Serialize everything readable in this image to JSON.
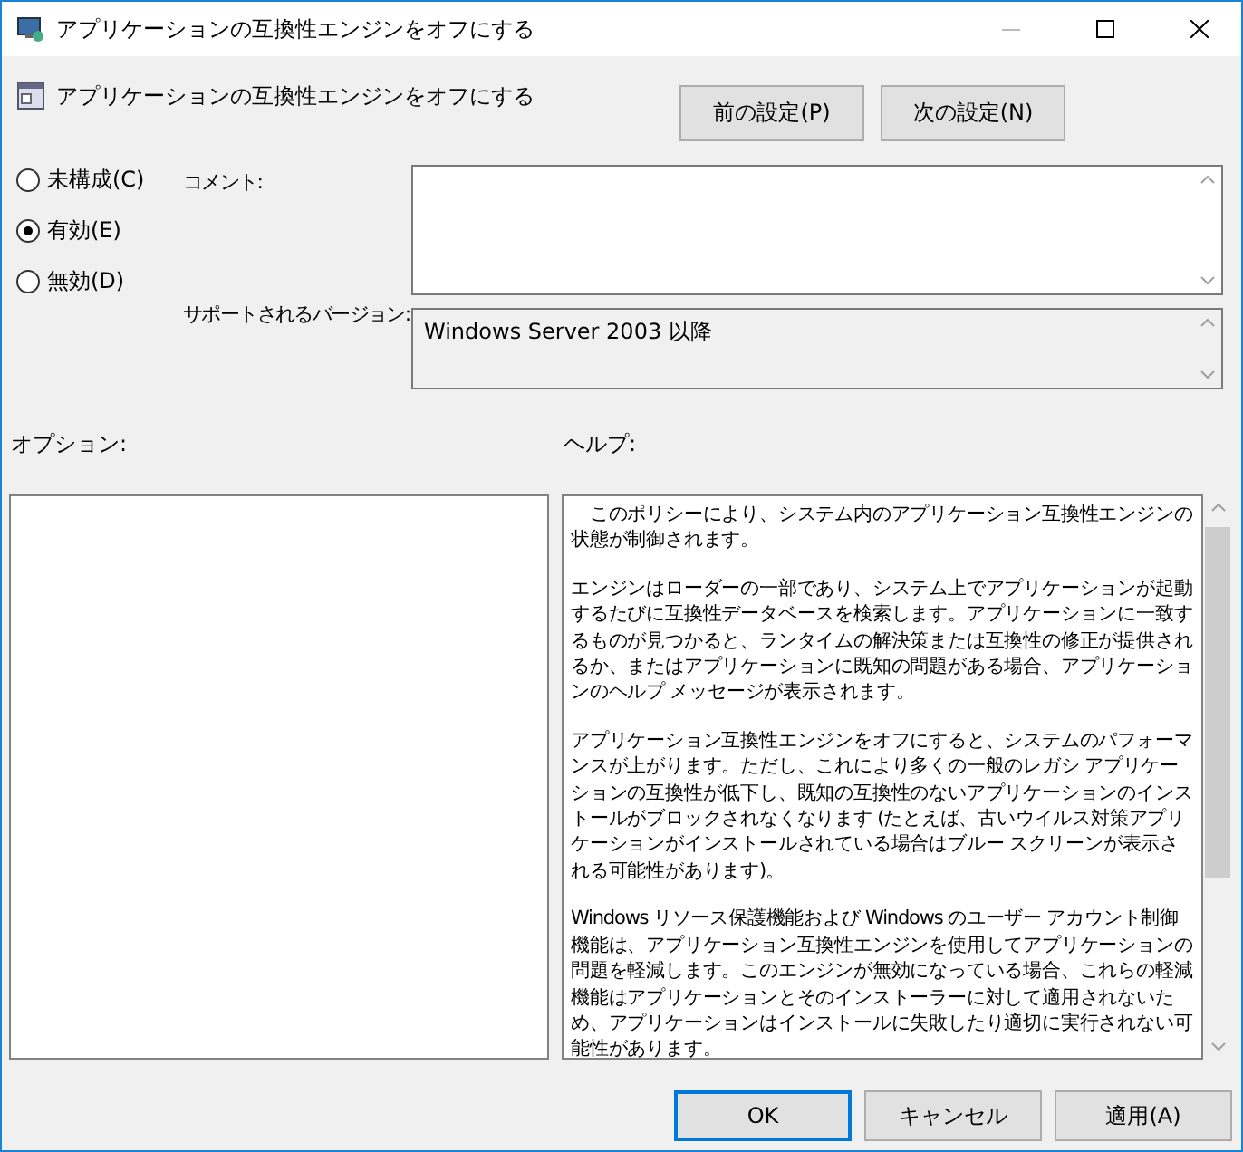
{
  "window": {
    "title": "アプリケーションの互換性エンジンをオフにする"
  },
  "header": {
    "title": "アプリケーションの互換性エンジンをオフにする"
  },
  "nav_buttons": [
    "前の設定(P)",
    "次の設定(N)"
  ],
  "radios": [
    {
      "label": "未構成(C)",
      "selected": false
    },
    {
      "label": "有効(E)",
      "selected": true
    },
    {
      "label": "無効(D)",
      "selected": false
    }
  ],
  "comment": {
    "label": "コメント:"
  },
  "supported": {
    "label": "サポートされるバージョン:",
    "value": "Windows Server 2003 以降"
  },
  "options": {
    "label": "オプション:"
  },
  "help": {
    "label": "ヘルプ:",
    "paragraphs": [
      "　このポリシーにより、システム内のアプリケーション互換性エンジンの状態が制御されます。",
      "エンジンはローダーの一部であり、システム上でアプリケーションが起動するたびに互換性データベースを検索します。アプリケーションに一致するものが見つかると、ランタイムの解決策または互換性の修正が提供されるか、またはアプリケーションに既知の問題がある場合、アプリケーションのヘルプ メッセージが表示されます。",
      "アプリケーション互換性エンジンをオフにすると、システムのパフォーマンスが上がります。ただし、これにより多くの一般のレガシ アプリケーションの互換性が低下し、既知の互換性のないアプリケーションのインストールがブロックされなくなります (たとえば、古いウイルス対策アプリケーションがインストールされている場合はブルー スクリーンが表示される可能性があります)。",
      "Windows リソース保護機能および Windows のユーザー アカウント制御機能は、アプリケーション互換性エンジンを使用してアプリケーションの問題を軽減します。このエンジンが無効になっている場合、これらの軽減機能はアプリケーションとそのインストーラーに対して適用されないため、アプリケーションはインストールに失敗したり適切に実行されない可能性があります。"
    ]
  },
  "buttons": [
    {
      "label": "OK",
      "kind": "default"
    },
    {
      "label": "キャンセル",
      "kind": "normal"
    },
    {
      "label": "適用(A)",
      "kind": "normal"
    }
  ]
}
